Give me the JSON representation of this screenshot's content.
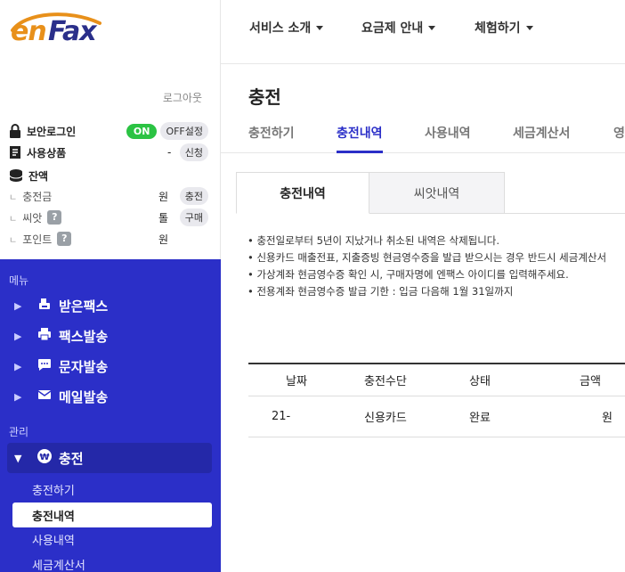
{
  "logo": {
    "text_e": "en",
    "text_f": "Fax"
  },
  "account": {
    "logout": "로그아웃",
    "secure_login": {
      "label": "보안로그인",
      "on": "ON",
      "off": "OFF",
      "setting": "설정"
    },
    "product": {
      "label": "사용상품",
      "value": "-",
      "action": "신청"
    },
    "balance": {
      "label": "잔액"
    },
    "charge": {
      "label": "충전금",
      "value": "원",
      "action": "충전"
    },
    "seed": {
      "label": "씨앗",
      "value": "톨",
      "action": "구매"
    },
    "point": {
      "label": "포인트",
      "value": "원"
    },
    "help": "?"
  },
  "menu": {
    "caption_menu": "메뉴",
    "caption_manage": "관리",
    "items": [
      {
        "label": "받은팩스",
        "icon": "fax-inbox-icon"
      },
      {
        "label": "팩스발송",
        "icon": "printer-icon"
      },
      {
        "label": "문자발송",
        "icon": "chat-icon"
      },
      {
        "label": "메일발송",
        "icon": "mail-icon"
      }
    ],
    "active": {
      "label": "충전",
      "icon": "won-coin-icon"
    },
    "sub_items": [
      "충전하기",
      "충전내역",
      "사용내역",
      "세금계산서"
    ],
    "selected_sub": "충전내역"
  },
  "topnav": [
    "서비스 소개",
    "요금제 안내",
    "체험하기"
  ],
  "page": {
    "title": "충전",
    "tabs": [
      "충전하기",
      "충전내역",
      "사용내역",
      "세금계산서",
      "영"
    ],
    "active_tab": "충전내역",
    "subtabs": [
      "충전내역",
      "씨앗내역"
    ],
    "notes": [
      "충전일로부터 5년이 지났거나 취소된 내역은 삭제됩니다.",
      "신용카드 매출전표, 지출증빙 현금영수증을 발급 받으시는 경우 반드시 세금계산서",
      "가상계좌 현금영수증 확인 시, 구매자명에 엔팩스 아이디를 입력해주세요.",
      "전용계좌 현금영수증 발급 기한 : 입금 다음해 1월 31일까지"
    ],
    "table": {
      "headers": [
        "날짜",
        "충전수단",
        "상태",
        "금액"
      ],
      "rows": [
        [
          "21-",
          "신용카드",
          "완료",
          "원"
        ]
      ]
    }
  },
  "colors": {
    "brand_blue": "#2b2fc8",
    "on_green": "#2bc343",
    "logo_orange": "#e8901a"
  }
}
